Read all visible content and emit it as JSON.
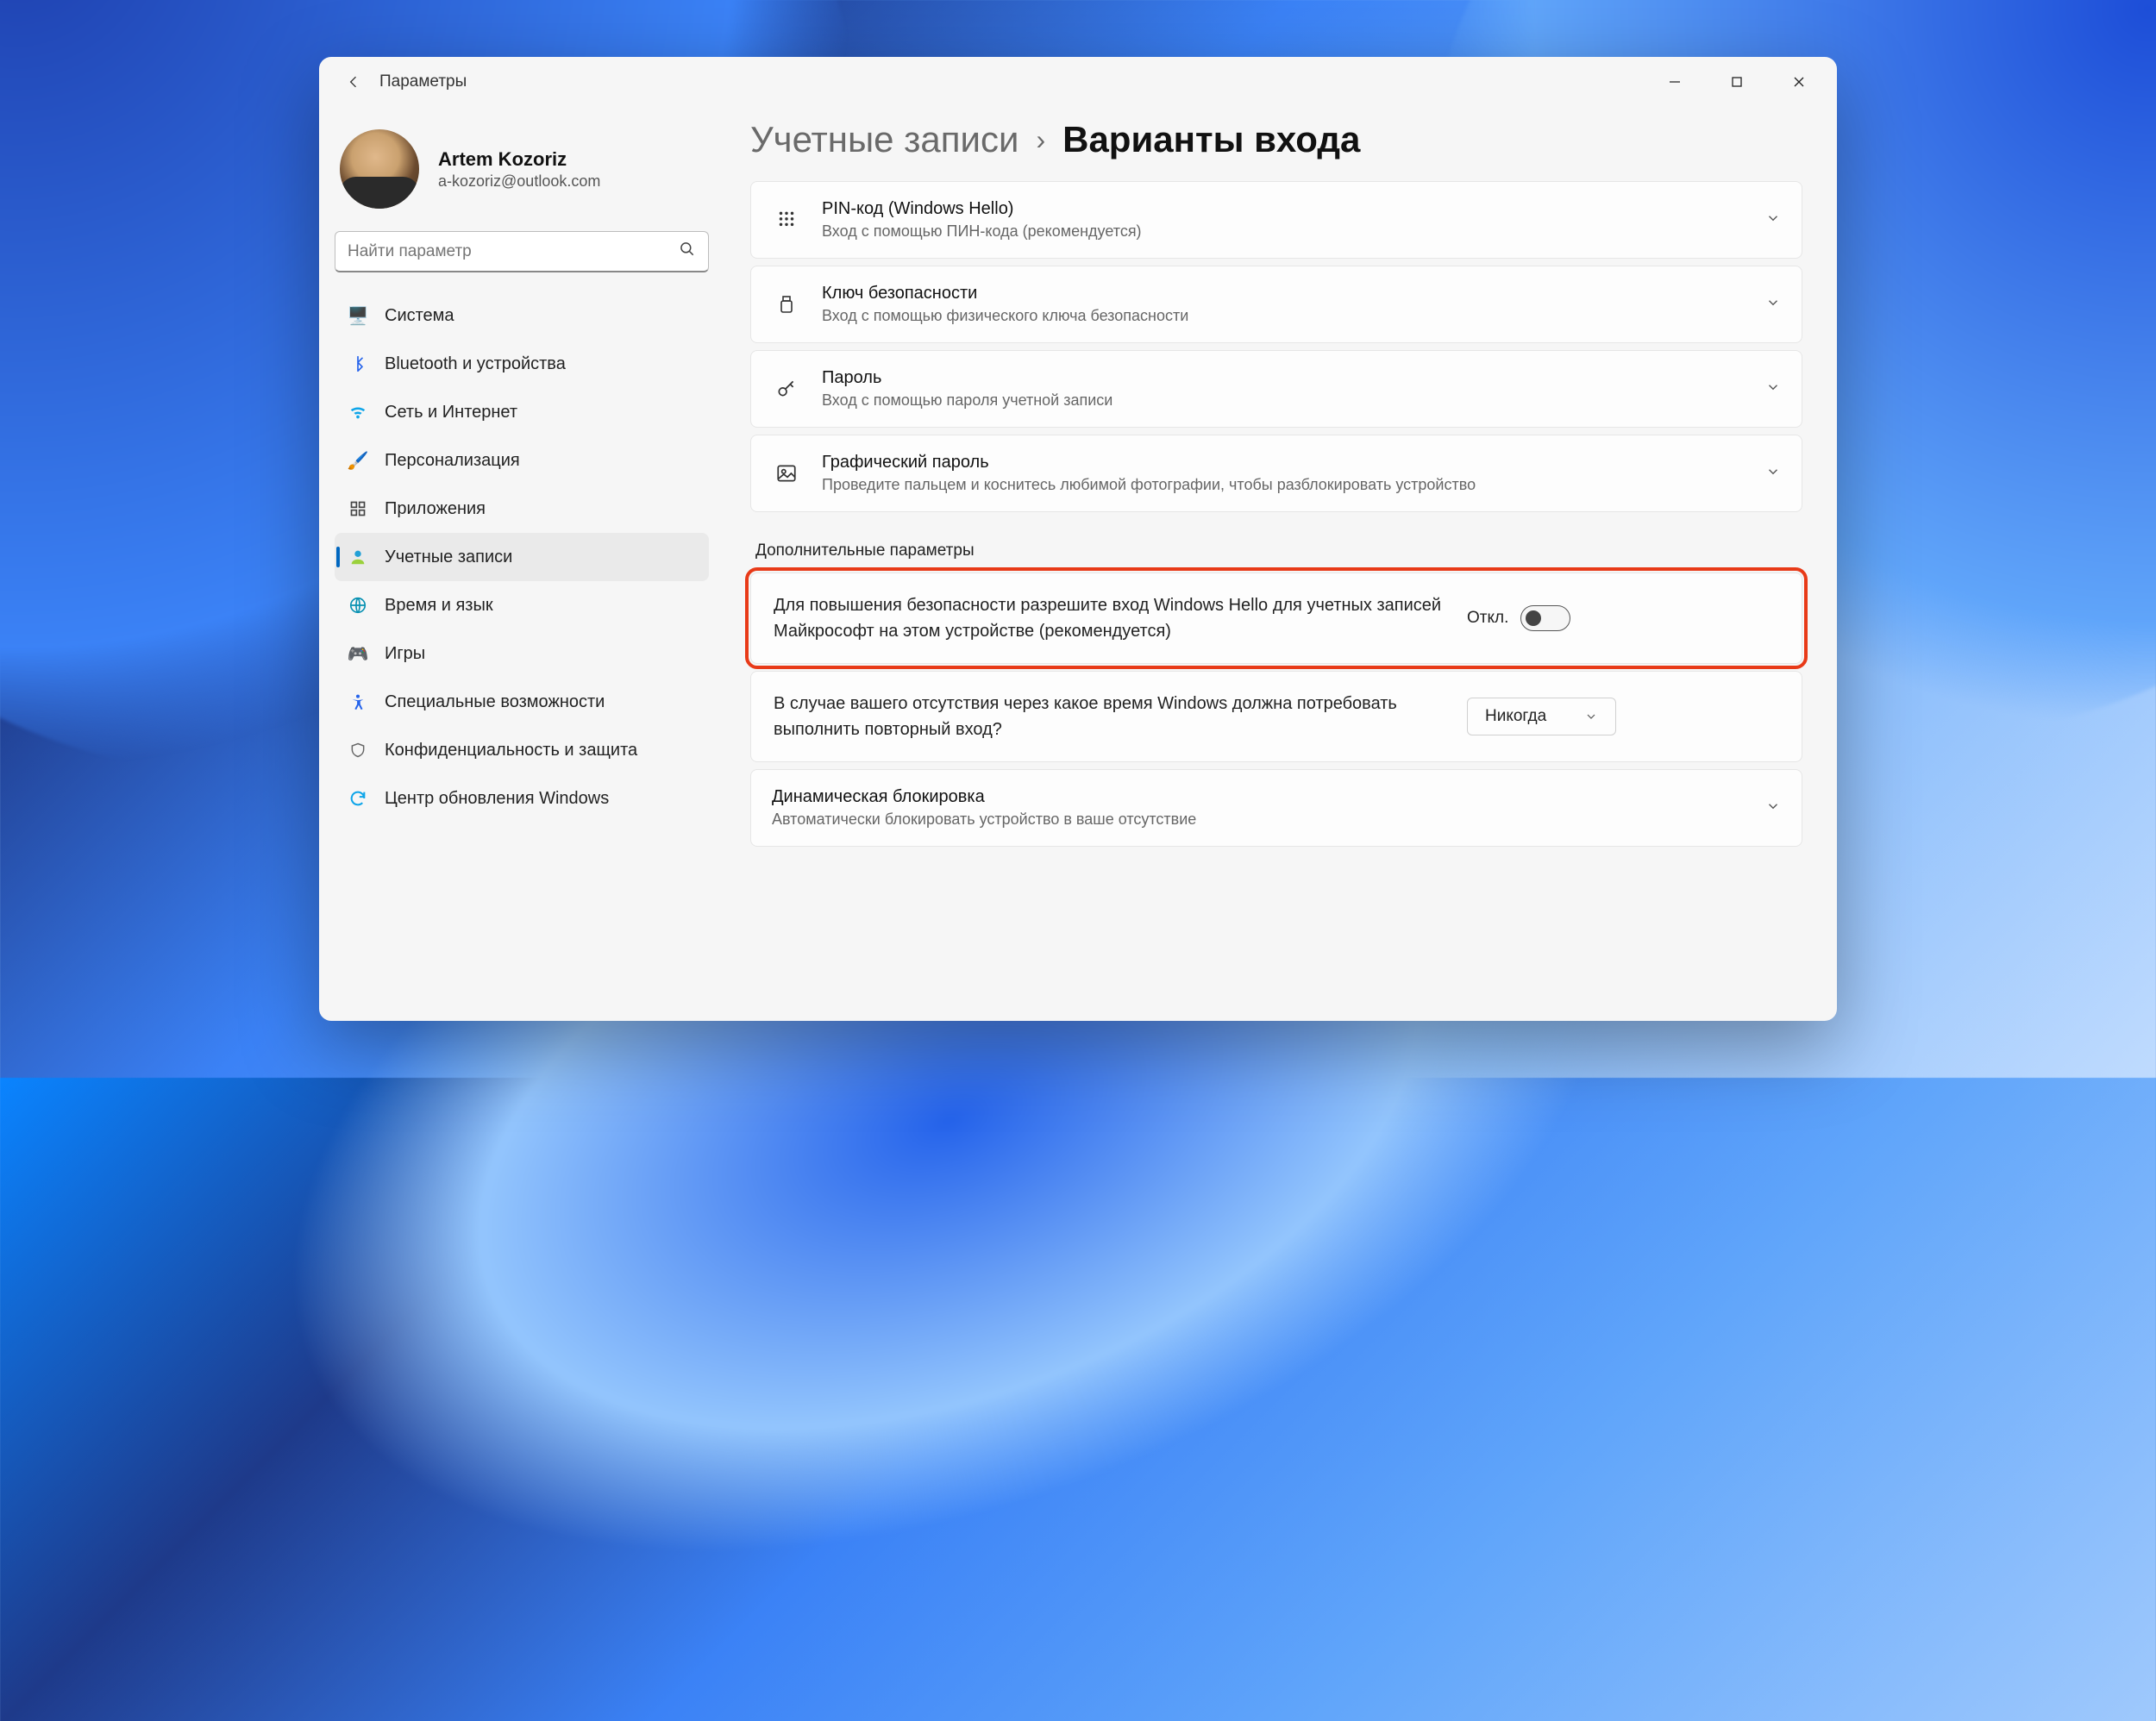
{
  "app": {
    "title": "Параметры"
  },
  "profile": {
    "name": "Artem Kozoriz",
    "email": "a-kozoriz@outlook.com"
  },
  "search": {
    "placeholder": "Найти параметр"
  },
  "sidebar": {
    "items": [
      {
        "label": "Система",
        "icon": "💻",
        "active": false
      },
      {
        "label": "Bluetooth и устройства",
        "icon": "ᚼ",
        "active": false
      },
      {
        "label": "Сеть и Интернет",
        "icon": "📶",
        "active": false
      },
      {
        "label": "Персонализация",
        "icon": "🖌️",
        "active": false
      },
      {
        "label": "Приложения",
        "icon": "▦",
        "active": false
      },
      {
        "label": "Учетные записи",
        "icon": "👤",
        "active": true
      },
      {
        "label": "Время и язык",
        "icon": "🌐",
        "active": false
      },
      {
        "label": "Игры",
        "icon": "🎮",
        "active": false
      },
      {
        "label": "Специальные возможности",
        "icon": "✲",
        "active": false
      },
      {
        "label": "Конфиденциальность и защита",
        "icon": "🛡️",
        "active": false
      },
      {
        "label": "Центр обновления Windows",
        "icon": "🔄",
        "active": false
      }
    ]
  },
  "breadcrumb": {
    "parent": "Учетные записи",
    "current": "Варианты входа"
  },
  "options": [
    {
      "title": "PIN-код (Windows Hello)",
      "sub": "Вход с помощью ПИН-кода (рекомендуется)",
      "icon": "keypad"
    },
    {
      "title": "Ключ безопасности",
      "sub": "Вход с помощью физического ключа безопасности",
      "icon": "usb"
    },
    {
      "title": "Пароль",
      "sub": "Вход с помощью пароля учетной записи",
      "icon": "key"
    },
    {
      "title": "Графический пароль",
      "sub": "Проведите пальцем и коснитесь любимой фотографии, чтобы разблокировать устройство",
      "icon": "picture"
    }
  ],
  "extra": {
    "heading": "Дополнительные параметры",
    "hello": {
      "text": "Для повышения безопасности разрешите вход Windows Hello для учетных записей Майкрософт на этом устройстве (рекомендуется)",
      "state_label": "Откл.",
      "state": false
    },
    "timeout": {
      "text": "В случае вашего отсутствия через какое время Windows должна потребовать выполнить повторный вход?",
      "value": "Никогда"
    },
    "dynlock": {
      "title": "Динамическая блокировка",
      "sub": "Автоматически блокировать устройство в ваше отсутствие"
    }
  }
}
